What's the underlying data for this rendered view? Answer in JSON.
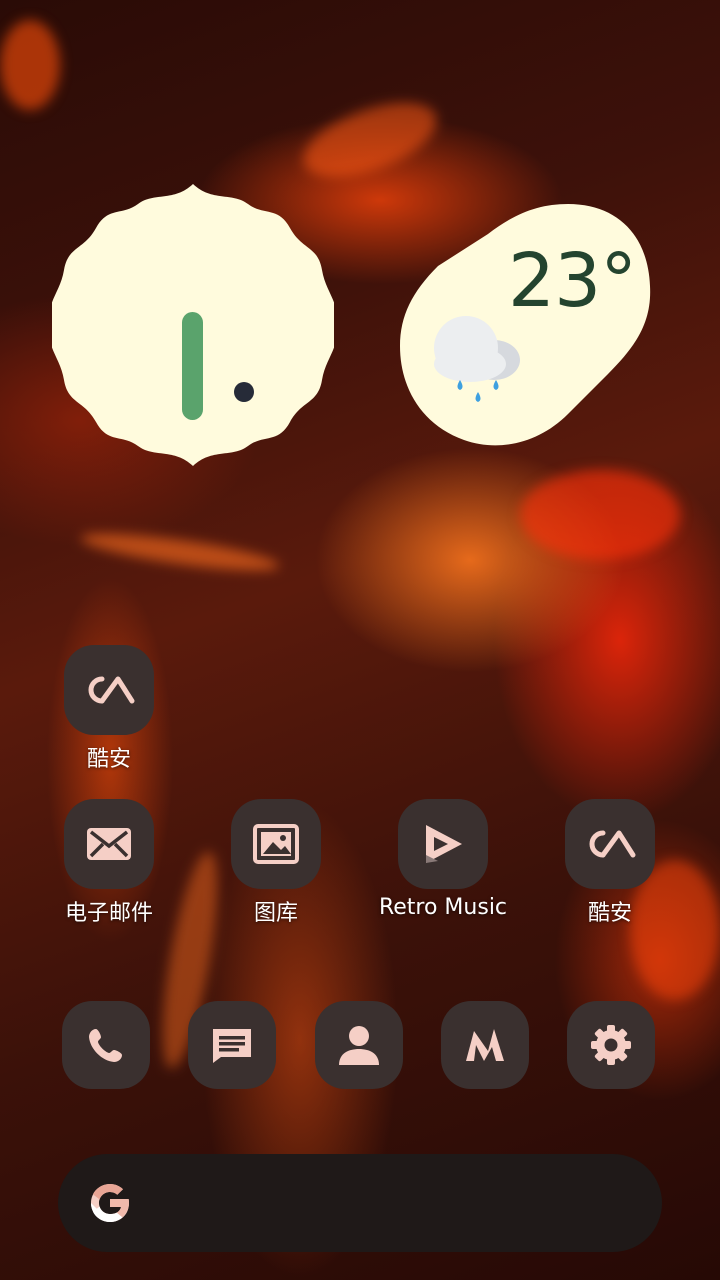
{
  "clock": {
    "hour_hand_color": "#5aa36c",
    "dot_color": "#262b38",
    "face_color": "#fffbdd"
  },
  "weather": {
    "temperature": "23°",
    "condition_icon": "cloud-rain-icon"
  },
  "home_apps": [
    {
      "label": "酷安",
      "icon": "coolapk-icon"
    },
    {
      "label": "电子邮件",
      "icon": "email-icon"
    },
    {
      "label": "图库",
      "icon": "gallery-icon"
    },
    {
      "label": "Retro Music",
      "icon": "retro-music-icon"
    },
    {
      "label": "酷安",
      "icon": "coolapk-icon"
    }
  ],
  "dock": [
    {
      "icon": "phone-icon"
    },
    {
      "icon": "messages-icon"
    },
    {
      "icon": "contacts-icon"
    },
    {
      "icon": "nova-icon"
    },
    {
      "icon": "settings-gear-icon"
    }
  ],
  "search": {
    "icon": "google-g-icon"
  },
  "colors": {
    "icon_bg": "#3a302f",
    "icon_fg": "#f5cfc6",
    "search_bg": "#1f1918"
  }
}
